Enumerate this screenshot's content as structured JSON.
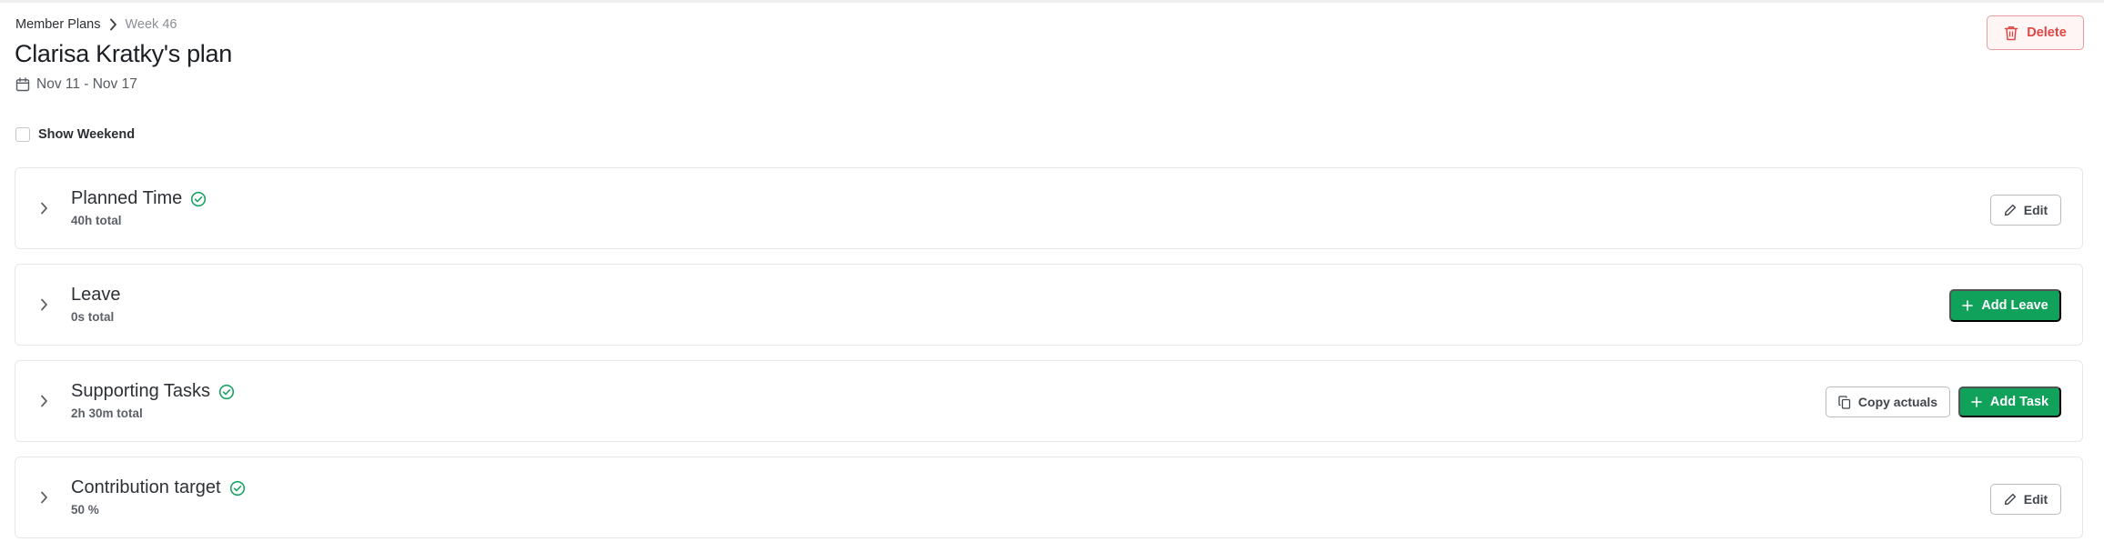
{
  "breadcrumb": {
    "parent": "Member Plans",
    "current": "Week 46"
  },
  "page": {
    "title": "Clarisa Kratky's plan",
    "date_range": "Nov 11 - Nov 17"
  },
  "actions": {
    "delete_label": "Delete"
  },
  "options": {
    "show_weekend_label": "Show Weekend",
    "show_weekend_checked": false
  },
  "sections": {
    "planned_time": {
      "title": "Planned Time",
      "total": "40h total",
      "complete": true,
      "edit_label": "Edit"
    },
    "leave": {
      "title": "Leave",
      "total": "0s total",
      "add_label": "Add Leave"
    },
    "supporting_tasks": {
      "title": "Supporting Tasks",
      "total": "2h 30m total",
      "complete": true,
      "copy_label": "Copy actuals",
      "add_label": "Add Task"
    },
    "contribution_target": {
      "title": "Contribution target",
      "total": "50 %",
      "complete": true,
      "edit_label": "Edit"
    }
  },
  "colors": {
    "accent_green": "#10a15a",
    "danger_red": "#e04545",
    "check_green": "#1aa462"
  },
  "icons": [
    "chevron-right-icon",
    "calendar-icon",
    "trash-icon",
    "check-circle-icon",
    "pencil-icon",
    "plus-icon",
    "copy-icon"
  ]
}
